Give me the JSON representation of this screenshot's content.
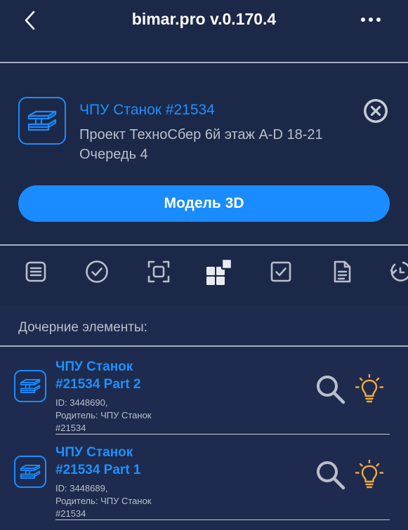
{
  "header": {
    "title": "bimar.pro v.0.170.4"
  },
  "card": {
    "title": "ЧПУ Станок #21534",
    "subtitle_line1": "Проект ТехноСбер 6й этаж A-D 18-21",
    "subtitle_line2": "Очередь 4",
    "model_button": "Модель 3D"
  },
  "toolbar": {
    "items": [
      "list-icon",
      "check-circle-icon",
      "focus-frame-icon",
      "blocks-icon",
      "checkbox-icon",
      "document-icon",
      "history-icon"
    ],
    "active_index": 3
  },
  "children": {
    "header": "Дочерние элементы:",
    "items": [
      {
        "title_line1": "ЧПУ Станок",
        "title_line2": "#21534 Part 2",
        "id_text": "ID: 3448690,",
        "parent_line1": "Родитель: ЧПУ Станок",
        "parent_line2": "#21534"
      },
      {
        "title_line1": "ЧПУ Станок",
        "title_line2": "#21534 Part 1",
        "id_text": "ID: 3448689,",
        "parent_line1": "Родитель: ЧПУ Станок",
        "parent_line2": "#21534"
      }
    ]
  },
  "colors": {
    "background": "#1c2848",
    "accent": "#1a8cff",
    "bulb": "#f2a93b"
  }
}
